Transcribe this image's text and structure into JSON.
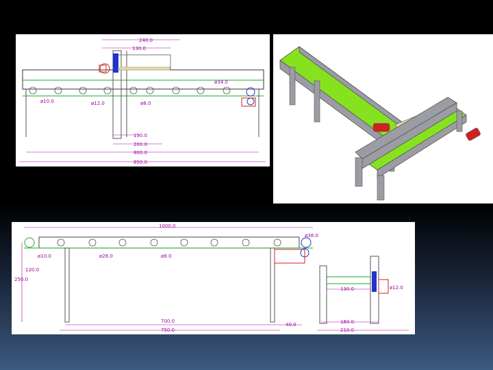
{
  "colors": {
    "frame": "#444444",
    "belt": "#1faa2a",
    "dimension": "#a100a1",
    "motor_red": "#cc2222",
    "bearing_blue": "#2233cc",
    "belt_3d": "#86e21e",
    "body_3d": "#9c9ca4",
    "accent_3d": "#e8d9a0"
  },
  "top_left": {
    "dims": [
      "240.0",
      "130.0",
      "ø34.0",
      "ø10.0",
      "ø12.0",
      "ø8.0",
      "150.0",
      "200.0",
      "800.0",
      "850.0"
    ]
  },
  "bottom": {
    "dims": [
      "1000.0",
      "ø38.0",
      "ø10.0",
      "ø26.0",
      "ø8.0",
      "120.0",
      "250.0",
      "700.0",
      "750.0",
      "40.0",
      "130.0",
      "160.0",
      "210.0",
      "ø12.0"
    ]
  },
  "icons": [
    "drawing-side-view",
    "drawing-3d-view",
    "drawing-front-view"
  ]
}
